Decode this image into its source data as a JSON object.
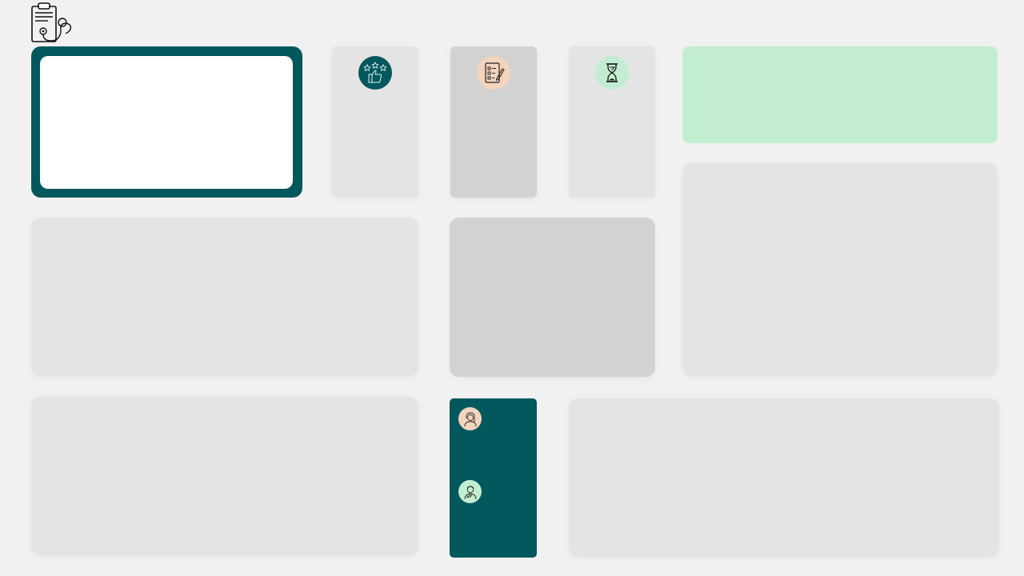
{
  "app": {
    "logo_icon": "clipboard-stethoscope-icon"
  },
  "colors": {
    "background": "#f1f1f1",
    "card": "#e4e4e4",
    "card_dark": "#d2d2d2",
    "teal": "#03585d",
    "mint": "#c3edd1",
    "peach": "#f3d4bd",
    "white": "#ffffff"
  },
  "stat_cards": [
    {
      "icon": "thumbs-up-stars-icon",
      "icon_bg": "#03585d"
    },
    {
      "icon": "checklist-pencil-icon",
      "icon_bg": "#f3d4bd"
    },
    {
      "icon": "hourglass-icon",
      "icon_bg": "#c3edd1"
    }
  ],
  "people_card": {
    "avatars": [
      {
        "icon": "female-patient-avatar-icon",
        "bg": "#f3d4bd"
      },
      {
        "icon": "male-doctor-avatar-icon",
        "bg": "#c3edd1"
      }
    ]
  }
}
